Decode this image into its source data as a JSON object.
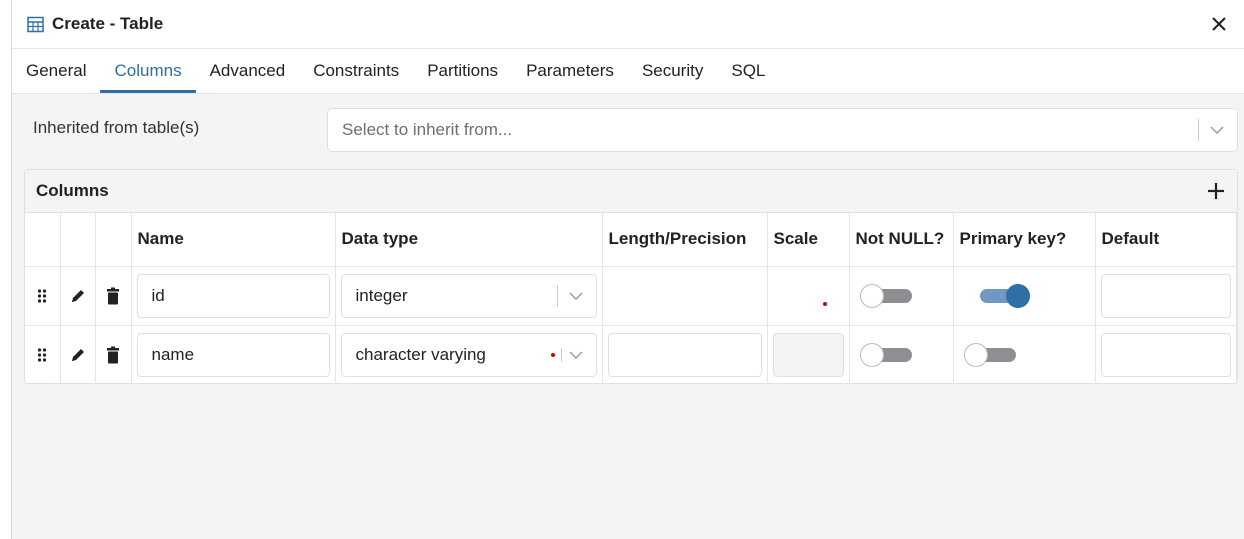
{
  "window": {
    "title": "Create - Table",
    "icon": "table-icon",
    "close_icon": "close-icon"
  },
  "tabs": [
    {
      "label": "General",
      "active": false
    },
    {
      "label": "Columns",
      "active": true
    },
    {
      "label": "Advanced",
      "active": false
    },
    {
      "label": "Constraints",
      "active": false
    },
    {
      "label": "Partitions",
      "active": false
    },
    {
      "label": "Parameters",
      "active": false
    },
    {
      "label": "Security",
      "active": false
    },
    {
      "label": "SQL",
      "active": false
    }
  ],
  "inherit": {
    "label": "Inherited from table(s)",
    "placeholder": "Select to inherit from..."
  },
  "columns_panel": {
    "title": "Columns",
    "add_icon": "plus-icon",
    "headers": [
      "Name",
      "Data type",
      "Length/Precision",
      "Scale",
      "Not NULL?",
      "Primary key?",
      "Default"
    ],
    "rows": [
      {
        "name": "id",
        "data_type": "integer",
        "length": "",
        "scale": "",
        "not_null": false,
        "primary_key": true,
        "default": ""
      },
      {
        "name": "name",
        "data_type": "character varying",
        "length": "",
        "scale": "",
        "not_null": false,
        "primary_key": false,
        "default": ""
      }
    ]
  },
  "colors": {
    "accent": "#2f6fa7",
    "error_dot": "#d40000",
    "background": "#f3f4f6"
  }
}
